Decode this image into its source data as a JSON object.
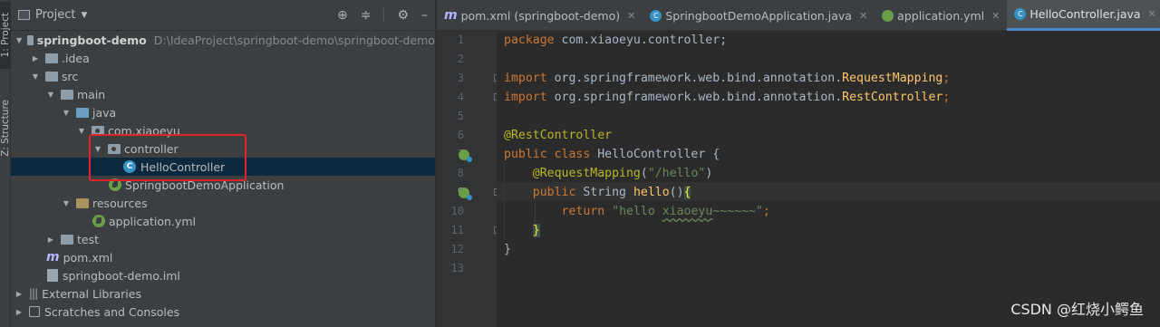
{
  "toolstrip": {
    "project_tab": "1: Project",
    "structure_tab": "Z: Structure"
  },
  "project_panel": {
    "title": "Project",
    "tree": [
      {
        "label": "springboot-demo",
        "path": "D:\\IdeaProject\\springboot-demo\\springboot-demo",
        "icon": "module-folder-icon"
      },
      {
        "label": ".idea",
        "icon": "folder-icon"
      },
      {
        "label": "src",
        "icon": "folder-icon"
      },
      {
        "label": "main",
        "icon": "folder-icon"
      },
      {
        "label": "java",
        "icon": "source-folder-icon"
      },
      {
        "label": "com.xiaoeyu",
        "icon": "package-icon"
      },
      {
        "label": "controller",
        "icon": "package-icon"
      },
      {
        "label": "HelloController",
        "icon": "class-icon"
      },
      {
        "label": "SpringbootDemoApplication",
        "icon": "spring-class-icon"
      },
      {
        "label": "resources",
        "icon": "resources-folder-icon"
      },
      {
        "label": "application.yml",
        "icon": "spring-config-icon"
      },
      {
        "label": "test",
        "icon": "folder-icon"
      },
      {
        "label": "pom.xml",
        "icon": "maven-icon"
      },
      {
        "label": "springboot-demo.iml",
        "icon": "iml-file-icon"
      },
      {
        "label": "External Libraries",
        "icon": "libraries-icon"
      },
      {
        "label": "Scratches and Consoles",
        "icon": "scratches-icon"
      }
    ]
  },
  "editor_tabs": [
    {
      "label": "pom.xml (springboot-demo)",
      "icon": "maven-icon"
    },
    {
      "label": "SpringbootDemoApplication.java",
      "icon": "class-icon"
    },
    {
      "label": "application.yml",
      "icon": "spring-config-icon"
    },
    {
      "label": "HelloController.java",
      "icon": "class-icon",
      "active": true
    }
  ],
  "code": {
    "line_numbers": [
      "1",
      "2",
      "3",
      "4",
      "5",
      "6",
      "7",
      "8",
      "9",
      "10",
      "11",
      "12",
      "13"
    ],
    "line1": {
      "kw": "package",
      "rest": " com.xiaoeyu.controller;"
    },
    "line3": {
      "kw": "import",
      "pkg": " org.springframework.web.bind.annotation.",
      "cls": "RequestMapping",
      "semi": ";"
    },
    "line4": {
      "kw": "import",
      "pkg": " org.springframework.web.bind.annotation.",
      "cls": "RestController",
      "semi": ";"
    },
    "line6": {
      "annotation": "@RestController"
    },
    "line7": {
      "kw": "public class",
      "name": " HelloController {"
    },
    "line8": {
      "annotation": "@RequestMapping",
      "open": "(",
      "string": "\"/hello\"",
      "close": ")"
    },
    "line9": {
      "kw": "public",
      "type": " String ",
      "method": "hello",
      "paren": "()",
      "brace": "{"
    },
    "line10": {
      "kw": "return",
      "str_a": "\"hello ",
      "str_b": "xiaoeyu",
      "str_c": "~~~~~~\"",
      "semi": ";"
    },
    "line11": {
      "brace": "}"
    },
    "line12": {
      "brace": "}"
    }
  },
  "watermark": "CSDN @红烧小鳄鱼"
}
